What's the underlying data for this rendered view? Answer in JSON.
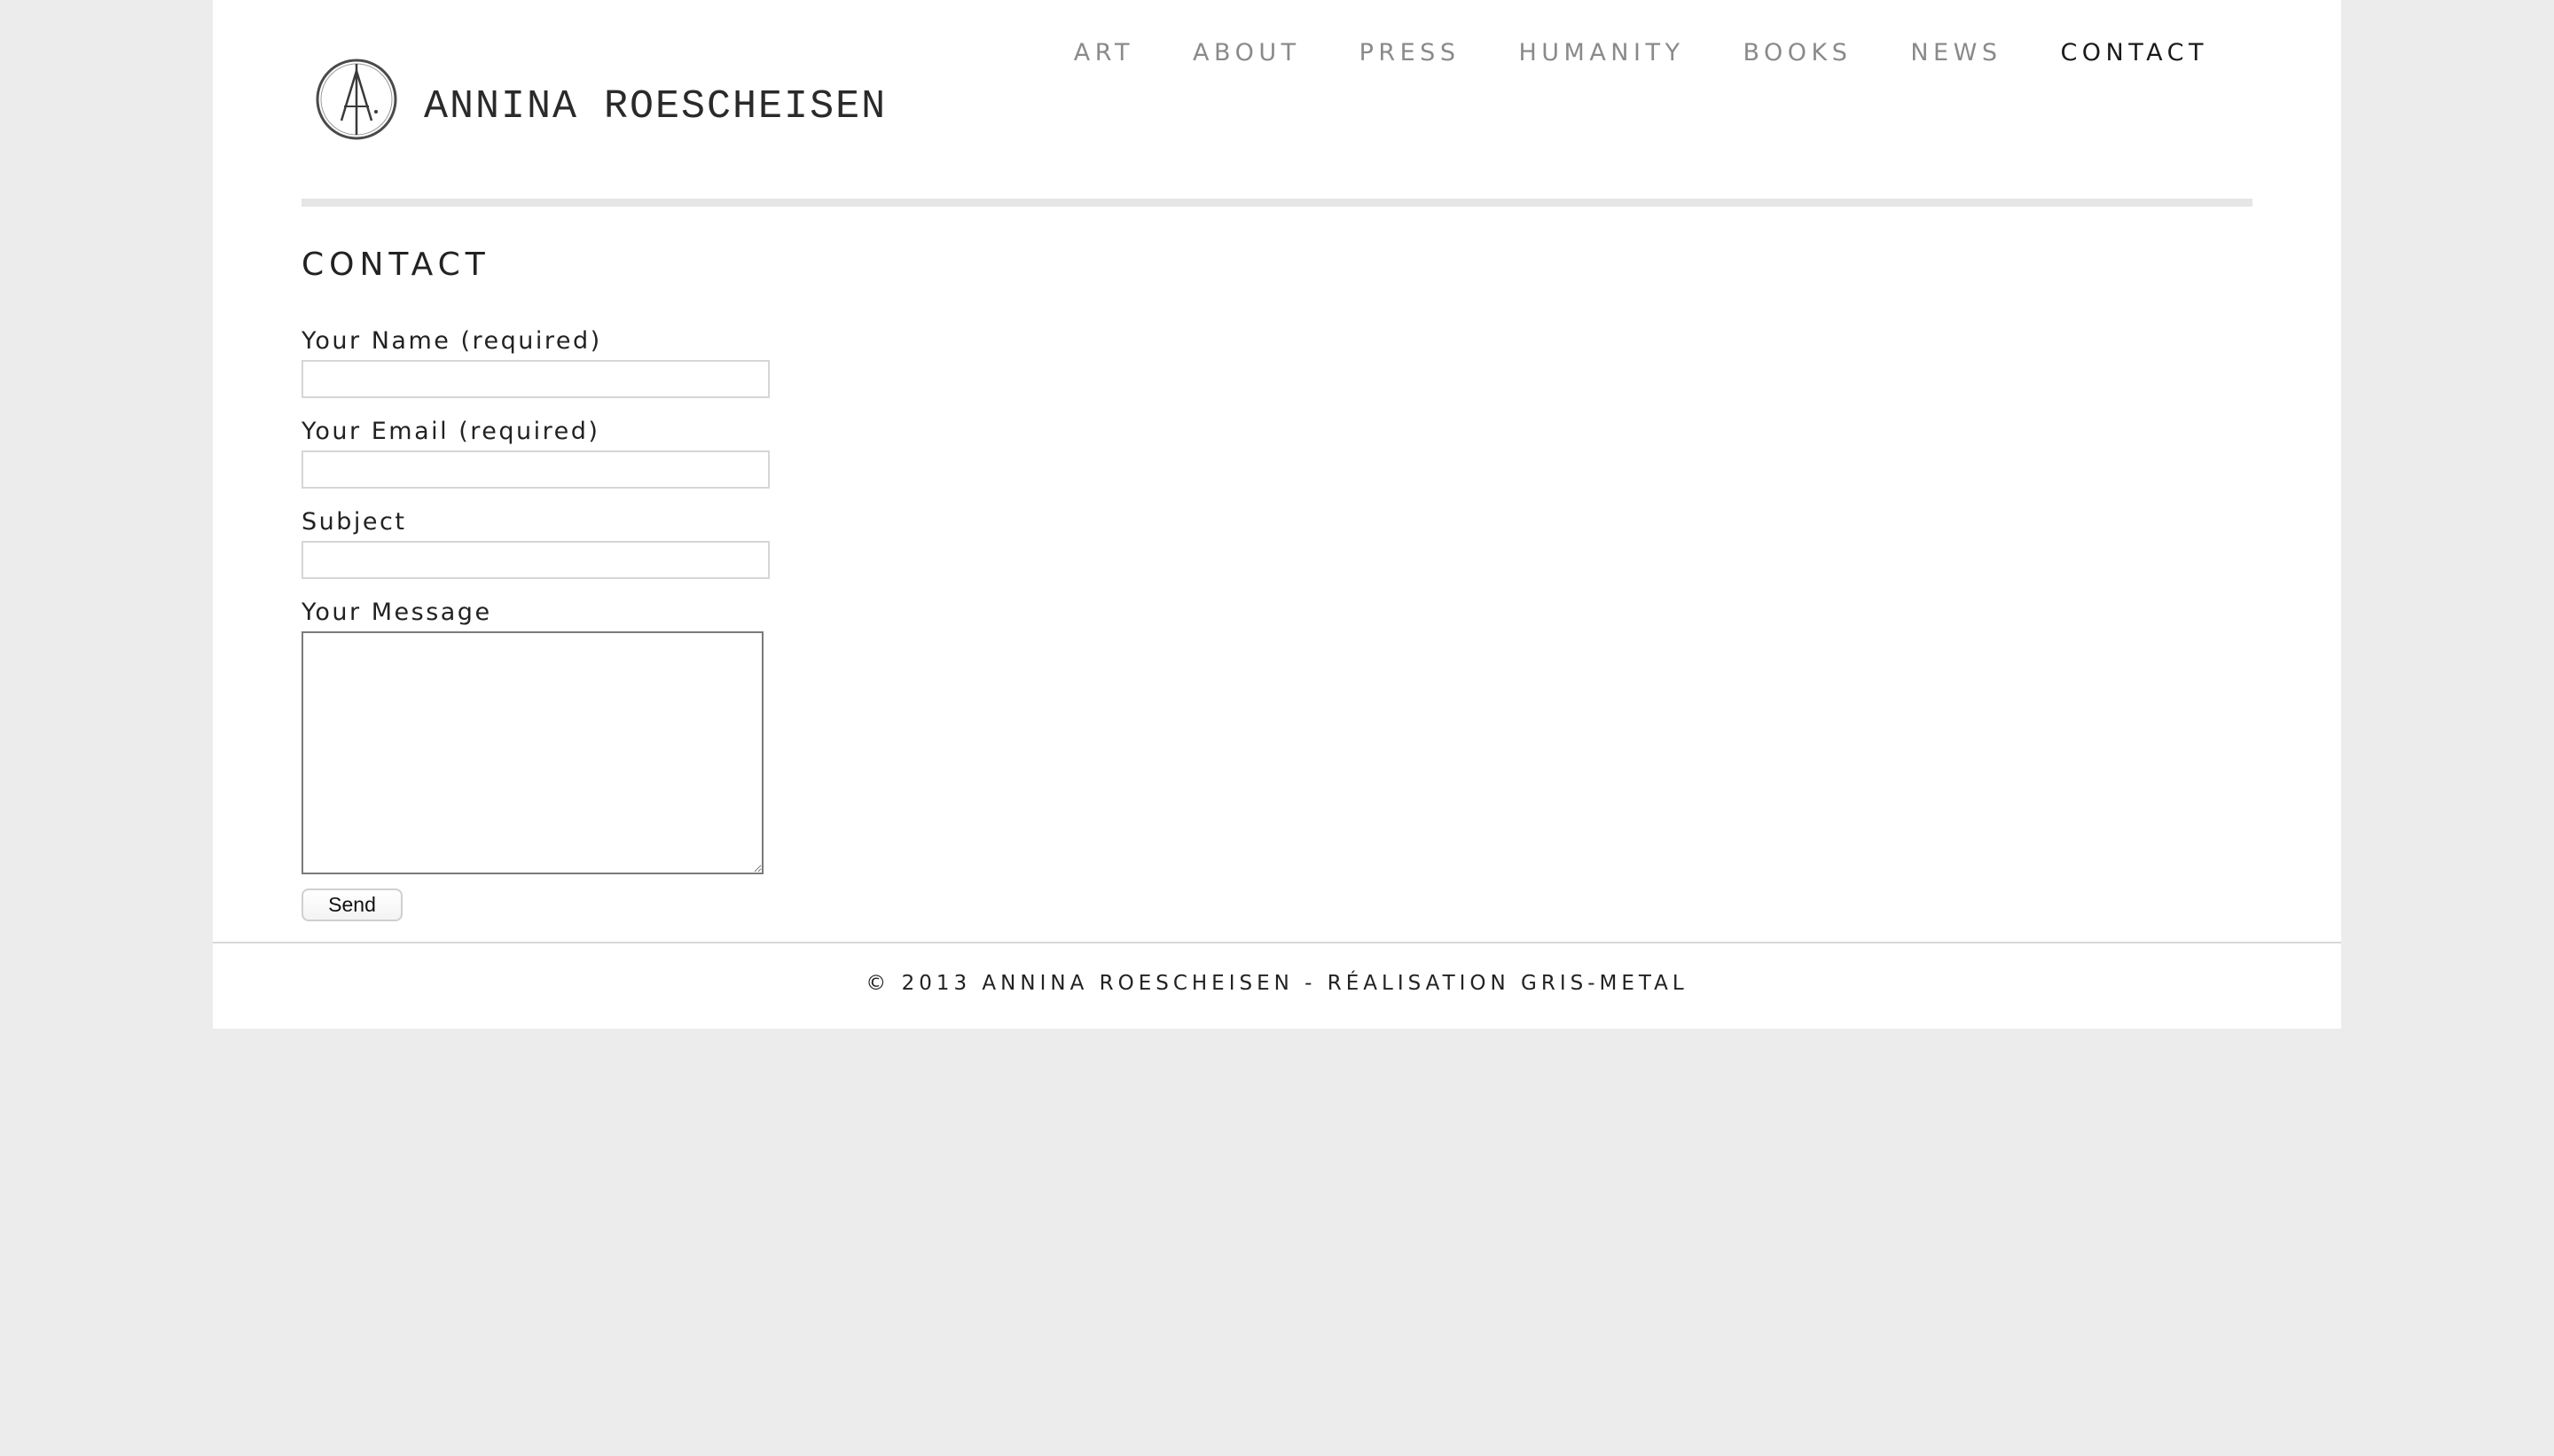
{
  "header": {
    "logo_text": "ANNINA ROESCHEISEN",
    "logo_icon": "compass-a-monogram-icon"
  },
  "nav": {
    "items": [
      {
        "label": "ART",
        "active": false
      },
      {
        "label": "ABOUT",
        "active": false
      },
      {
        "label": "PRESS",
        "active": false
      },
      {
        "label": "HUMANITY",
        "active": false
      },
      {
        "label": "BOOKS",
        "active": false
      },
      {
        "label": "NEWS",
        "active": false
      },
      {
        "label": "CONTACT",
        "active": true
      }
    ]
  },
  "main": {
    "title": "CONTACT",
    "form": {
      "name_label": "Your Name (required)",
      "name_value": "",
      "email_label": "Your Email (required)",
      "email_value": "",
      "subject_label": "Subject",
      "subject_value": "",
      "message_label": "Your Message",
      "message_value": "",
      "send_label": "Send"
    }
  },
  "footer": {
    "text": "© 2013 ANNINA ROESCHEISEN - RÉALISATION GRIS-METAL"
  },
  "colors": {
    "background": "#ececec",
    "page": "#ffffff",
    "nav_inactive": "#8a8a8a",
    "nav_active": "#1a1a1a"
  }
}
